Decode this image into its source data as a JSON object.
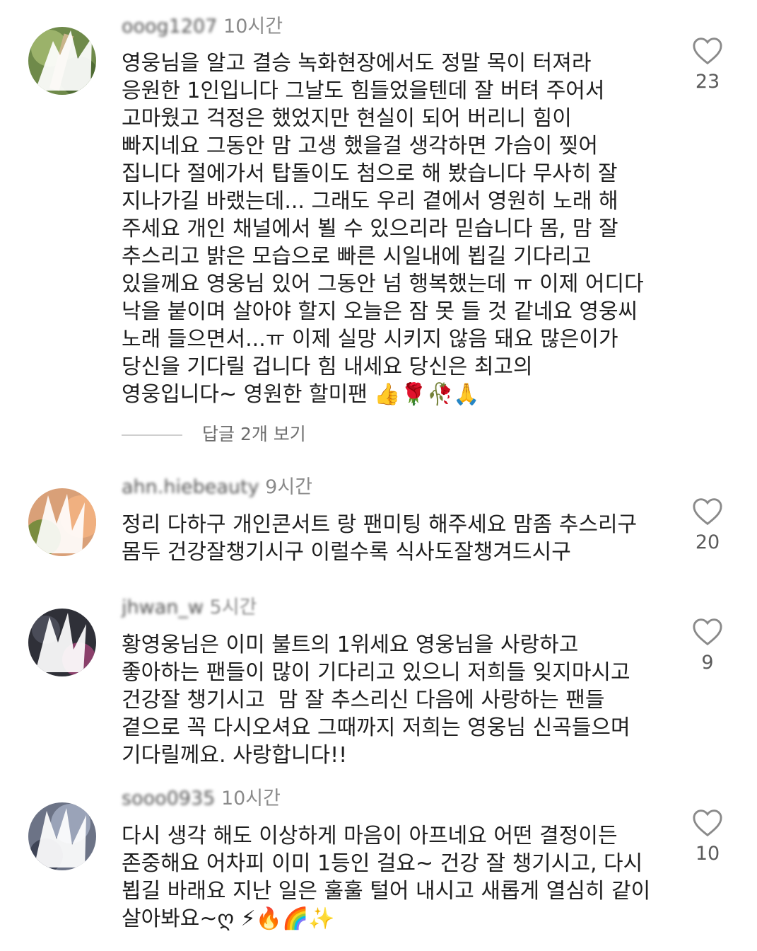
{
  "comments": [
    {
      "username": "ooog1207",
      "time": "10시간",
      "text": "영웅님을 알고 결승 녹화현장에서도 정말 목이 터져라\n응원한 1인입니다 그날도 힘들었을텐데 잘 버텨 주어서\n고마웠고 걱정은 했었지만 현실이 되어 버리니 힘이\n빠지네요 그동안 맘 고생 했을걸 생각하면 가슴이 찢어\n집니다 절에가서 탑돌이도 첨으로 해 봤습니다 무사히 잘\n지나가길 바랬는데... 그래도 우리 곁에서 영원히 노래 해\n주세요 개인 채널에서 뵐 수 있으리라 믿습니다 몸, 맘 잘\n추스리고 밝은 모습으로 빠른 시일내에 뵙길 기다리고\n있을께요 영웅님 있어 그동안 넘 행복했는데 ㅠ 이제 어디다\n낙을 붙이며 살아야 할지 오늘은 잠 못 들 것 같네요 영웅씨\n노래 들으면서...ㅠ 이제 실망 시키지 않음 돼요 많은이가\n당신을 기다릴 겁니다 힘 내세요 당신은 최고의\n영웅입니다~ 영원한 할미팬 👍🌹🥀🙏",
      "likes": "23",
      "replies_label": "답글 2개 보기"
    },
    {
      "username": "ahn.hiebeauty",
      "time": "9시간",
      "text": "정리 다하구 개인콘서트 랑 팬미팅 해주세요 맘좀 추스리구\n몸두 건강잘챙기시구 이럴수록 식사도잘챙겨드시구",
      "likes": "20"
    },
    {
      "username": "jhwan_w",
      "time": "5시간",
      "text": "황영웅님은 이미 불트의 1위세요 영웅님을 사랑하고\n좋아하는 팬들이 많이 기다리고 있으니 저희들 잊지마시고\n건강잘 챙기시고  맘 잘 추스리신 다음에 사랑하는 팬들\n곁으로 꼭 다시오셔요 그때까지 저희는 영웅님 신곡들으며\n기다릴께요. 사랑합니다!!",
      "likes": "9"
    },
    {
      "username": "sooo0935",
      "time": "10시간",
      "text": "다시 생각 해도 이상하게 마음이 아프네요 어떤 결정이든\n존중해요 어차피 이미 1등인 걸요~ 건강 잘 챙기시고, 다시\n뵙길 바래요 지난 일은 훌훌 털어 내시고 새롭게 열심히 같이\n살아봐요~ღ ⚡🔥🌈✨",
      "likes": "10"
    }
  ]
}
